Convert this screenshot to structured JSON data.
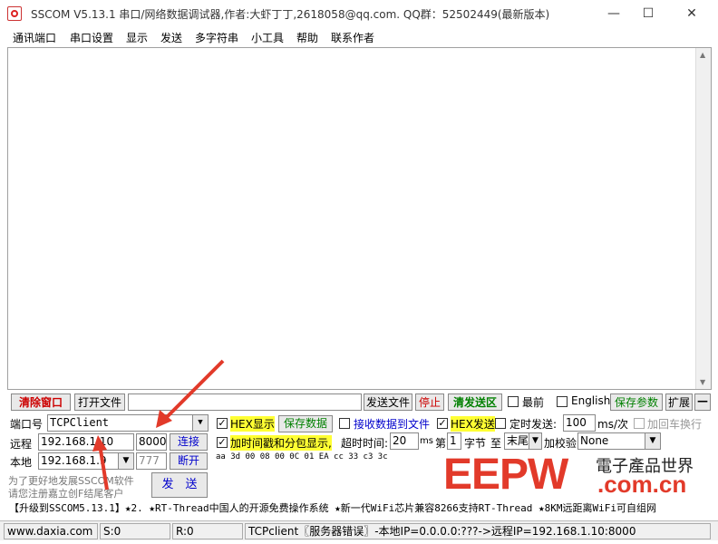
{
  "window": {
    "title": "SSCOM V5.13.1 串口/网络数据调试器,作者:大虾丁丁,2618058@qq.com. QQ群：52502449(最新版本)",
    "min_glyph": "—",
    "max_glyph": "☐",
    "close_glyph": "✕"
  },
  "menu": [
    "通讯端口",
    "串口设置",
    "显示",
    "发送",
    "多字符串",
    "小工具",
    "帮助",
    "联系作者"
  ],
  "toolbar": {
    "clear_window": "清除窗口",
    "open_file": "打开文件",
    "send_file": "发送文件",
    "stop": "停止",
    "clear_send": "清发送区",
    "front": "最前",
    "english": "English",
    "save_params": "保存参数",
    "expand": "扩展",
    "collapse": "—"
  },
  "port": {
    "label": "端口号",
    "value": "TCPClient",
    "remote_label": "远程",
    "remote_ip": "192.168.1.10",
    "remote_port": "8000",
    "connect": "连接",
    "local_label": "本地",
    "local_ip": "192.168.1.9",
    "local_port": "777",
    "disconnect": "断开",
    "promo_line1": "为了更好地发展SSCOM软件",
    "promo_line2": "请您注册嘉立创F结尾客户"
  },
  "options": {
    "hex_display": "HEX显示",
    "save_data": "保存数据",
    "recv_to_file": "接收数据到文件",
    "hex_send": "HEX发送",
    "timed_send": "定时发送:",
    "interval": "100",
    "interval_unit": "ms/次",
    "add_crlf": "加回车换行",
    "timestamp": "加时间戳和分包显示,",
    "timeout_label": "超时时间:",
    "timeout": "20",
    "ms": "ms",
    "nth_label": "第",
    "nth": "1",
    "byte_label": "字节",
    "to_label": "至",
    "end_value": "末尾",
    "checksum_label": "加校验",
    "checksum_value": "None",
    "send_button": "发　送"
  },
  "send_data": "aa 3d 00 08 00 0C 01 EA cc 33 c3 3c",
  "watermark": {
    "main": "EEPW",
    "cn": "電子產品世界",
    "domain": ".com.cn"
  },
  "ticker": "【升级到SSCOM5.13.1】★2. ★RT-Thread中国人的开源免费操作系统 ★新一代WiFi芯片兼容8266支持RT-Thread ★8KM远距离WiFi可自组网",
  "status": {
    "site": "www.daxia.com",
    "sent": "S:0",
    "recv": "R:0",
    "info": "TCPclient〖服务器错误〗-本地IP=0.0.0.0:???->远程IP=192.168.1.10:8000"
  },
  "colors": {
    "accent_red": "#e23a2a",
    "highlight": "#ffff33",
    "green_text": "#008000",
    "blue_text": "#0000cc"
  }
}
